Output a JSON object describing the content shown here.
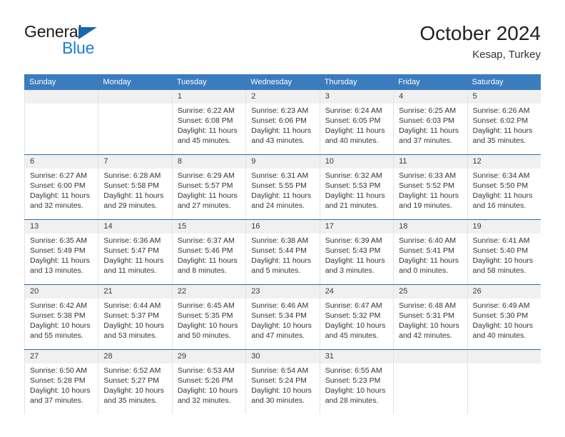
{
  "brand": {
    "name_top": "General",
    "name_bottom": "Blue",
    "triangle_color": "#1567b0",
    "blue_text_color": "#1b7fd4"
  },
  "header": {
    "title": "October 2024",
    "subtitle": "Kesap, Turkey"
  },
  "theme": {
    "header_row_bg": "#3a7cbe",
    "header_row_text": "#ffffff",
    "day_band_bg": "#f0f0f0",
    "week_separator": "#2f6ca5",
    "column_separator": "#e3e3e3",
    "body_text": "#333333"
  },
  "calendar": {
    "weekdays": [
      "Sunday",
      "Monday",
      "Tuesday",
      "Wednesday",
      "Thursday",
      "Friday",
      "Saturday"
    ],
    "weeks": [
      [
        {
          "day": "",
          "lines": [
            "",
            "",
            "",
            ""
          ],
          "empty": true
        },
        {
          "day": "",
          "lines": [
            "",
            "",
            "",
            ""
          ],
          "empty": true
        },
        {
          "day": "1",
          "lines": [
            "Sunrise: 6:22 AM",
            "Sunset: 6:08 PM",
            "Daylight: 11 hours",
            "and 45 minutes."
          ],
          "empty": false
        },
        {
          "day": "2",
          "lines": [
            "Sunrise: 6:23 AM",
            "Sunset: 6:06 PM",
            "Daylight: 11 hours",
            "and 43 minutes."
          ],
          "empty": false
        },
        {
          "day": "3",
          "lines": [
            "Sunrise: 6:24 AM",
            "Sunset: 6:05 PM",
            "Daylight: 11 hours",
            "and 40 minutes."
          ],
          "empty": false
        },
        {
          "day": "4",
          "lines": [
            "Sunrise: 6:25 AM",
            "Sunset: 6:03 PM",
            "Daylight: 11 hours",
            "and 37 minutes."
          ],
          "empty": false
        },
        {
          "day": "5",
          "lines": [
            "Sunrise: 6:26 AM",
            "Sunset: 6:02 PM",
            "Daylight: 11 hours",
            "and 35 minutes."
          ],
          "empty": false
        }
      ],
      [
        {
          "day": "6",
          "lines": [
            "Sunrise: 6:27 AM",
            "Sunset: 6:00 PM",
            "Daylight: 11 hours",
            "and 32 minutes."
          ],
          "empty": false
        },
        {
          "day": "7",
          "lines": [
            "Sunrise: 6:28 AM",
            "Sunset: 5:58 PM",
            "Daylight: 11 hours",
            "and 29 minutes."
          ],
          "empty": false
        },
        {
          "day": "8",
          "lines": [
            "Sunrise: 6:29 AM",
            "Sunset: 5:57 PM",
            "Daylight: 11 hours",
            "and 27 minutes."
          ],
          "empty": false
        },
        {
          "day": "9",
          "lines": [
            "Sunrise: 6:31 AM",
            "Sunset: 5:55 PM",
            "Daylight: 11 hours",
            "and 24 minutes."
          ],
          "empty": false
        },
        {
          "day": "10",
          "lines": [
            "Sunrise: 6:32 AM",
            "Sunset: 5:53 PM",
            "Daylight: 11 hours",
            "and 21 minutes."
          ],
          "empty": false
        },
        {
          "day": "11",
          "lines": [
            "Sunrise: 6:33 AM",
            "Sunset: 5:52 PM",
            "Daylight: 11 hours",
            "and 19 minutes."
          ],
          "empty": false
        },
        {
          "day": "12",
          "lines": [
            "Sunrise: 6:34 AM",
            "Sunset: 5:50 PM",
            "Daylight: 11 hours",
            "and 16 minutes."
          ],
          "empty": false
        }
      ],
      [
        {
          "day": "13",
          "lines": [
            "Sunrise: 6:35 AM",
            "Sunset: 5:49 PM",
            "Daylight: 11 hours",
            "and 13 minutes."
          ],
          "empty": false
        },
        {
          "day": "14",
          "lines": [
            "Sunrise: 6:36 AM",
            "Sunset: 5:47 PM",
            "Daylight: 11 hours",
            "and 11 minutes."
          ],
          "empty": false
        },
        {
          "day": "15",
          "lines": [
            "Sunrise: 6:37 AM",
            "Sunset: 5:46 PM",
            "Daylight: 11 hours",
            "and 8 minutes."
          ],
          "empty": false
        },
        {
          "day": "16",
          "lines": [
            "Sunrise: 6:38 AM",
            "Sunset: 5:44 PM",
            "Daylight: 11 hours",
            "and 5 minutes."
          ],
          "empty": false
        },
        {
          "day": "17",
          "lines": [
            "Sunrise: 6:39 AM",
            "Sunset: 5:43 PM",
            "Daylight: 11 hours",
            "and 3 minutes."
          ],
          "empty": false
        },
        {
          "day": "18",
          "lines": [
            "Sunrise: 6:40 AM",
            "Sunset: 5:41 PM",
            "Daylight: 11 hours",
            "and 0 minutes."
          ],
          "empty": false
        },
        {
          "day": "19",
          "lines": [
            "Sunrise: 6:41 AM",
            "Sunset: 5:40 PM",
            "Daylight: 10 hours",
            "and 58 minutes."
          ],
          "empty": false
        }
      ],
      [
        {
          "day": "20",
          "lines": [
            "Sunrise: 6:42 AM",
            "Sunset: 5:38 PM",
            "Daylight: 10 hours",
            "and 55 minutes."
          ],
          "empty": false
        },
        {
          "day": "21",
          "lines": [
            "Sunrise: 6:44 AM",
            "Sunset: 5:37 PM",
            "Daylight: 10 hours",
            "and 53 minutes."
          ],
          "empty": false
        },
        {
          "day": "22",
          "lines": [
            "Sunrise: 6:45 AM",
            "Sunset: 5:35 PM",
            "Daylight: 10 hours",
            "and 50 minutes."
          ],
          "empty": false
        },
        {
          "day": "23",
          "lines": [
            "Sunrise: 6:46 AM",
            "Sunset: 5:34 PM",
            "Daylight: 10 hours",
            "and 47 minutes."
          ],
          "empty": false
        },
        {
          "day": "24",
          "lines": [
            "Sunrise: 6:47 AM",
            "Sunset: 5:32 PM",
            "Daylight: 10 hours",
            "and 45 minutes."
          ],
          "empty": false
        },
        {
          "day": "25",
          "lines": [
            "Sunrise: 6:48 AM",
            "Sunset: 5:31 PM",
            "Daylight: 10 hours",
            "and 42 minutes."
          ],
          "empty": false
        },
        {
          "day": "26",
          "lines": [
            "Sunrise: 6:49 AM",
            "Sunset: 5:30 PM",
            "Daylight: 10 hours",
            "and 40 minutes."
          ],
          "empty": false
        }
      ],
      [
        {
          "day": "27",
          "lines": [
            "Sunrise: 6:50 AM",
            "Sunset: 5:28 PM",
            "Daylight: 10 hours",
            "and 37 minutes."
          ],
          "empty": false
        },
        {
          "day": "28",
          "lines": [
            "Sunrise: 6:52 AM",
            "Sunset: 5:27 PM",
            "Daylight: 10 hours",
            "and 35 minutes."
          ],
          "empty": false
        },
        {
          "day": "29",
          "lines": [
            "Sunrise: 6:53 AM",
            "Sunset: 5:26 PM",
            "Daylight: 10 hours",
            "and 32 minutes."
          ],
          "empty": false
        },
        {
          "day": "30",
          "lines": [
            "Sunrise: 6:54 AM",
            "Sunset: 5:24 PM",
            "Daylight: 10 hours",
            "and 30 minutes."
          ],
          "empty": false
        },
        {
          "day": "31",
          "lines": [
            "Sunrise: 6:55 AM",
            "Sunset: 5:23 PM",
            "Daylight: 10 hours",
            "and 28 minutes."
          ],
          "empty": false
        },
        {
          "day": "",
          "lines": [
            "",
            "",
            "",
            ""
          ],
          "empty": true
        },
        {
          "day": "",
          "lines": [
            "",
            "",
            "",
            ""
          ],
          "empty": true
        }
      ]
    ]
  }
}
